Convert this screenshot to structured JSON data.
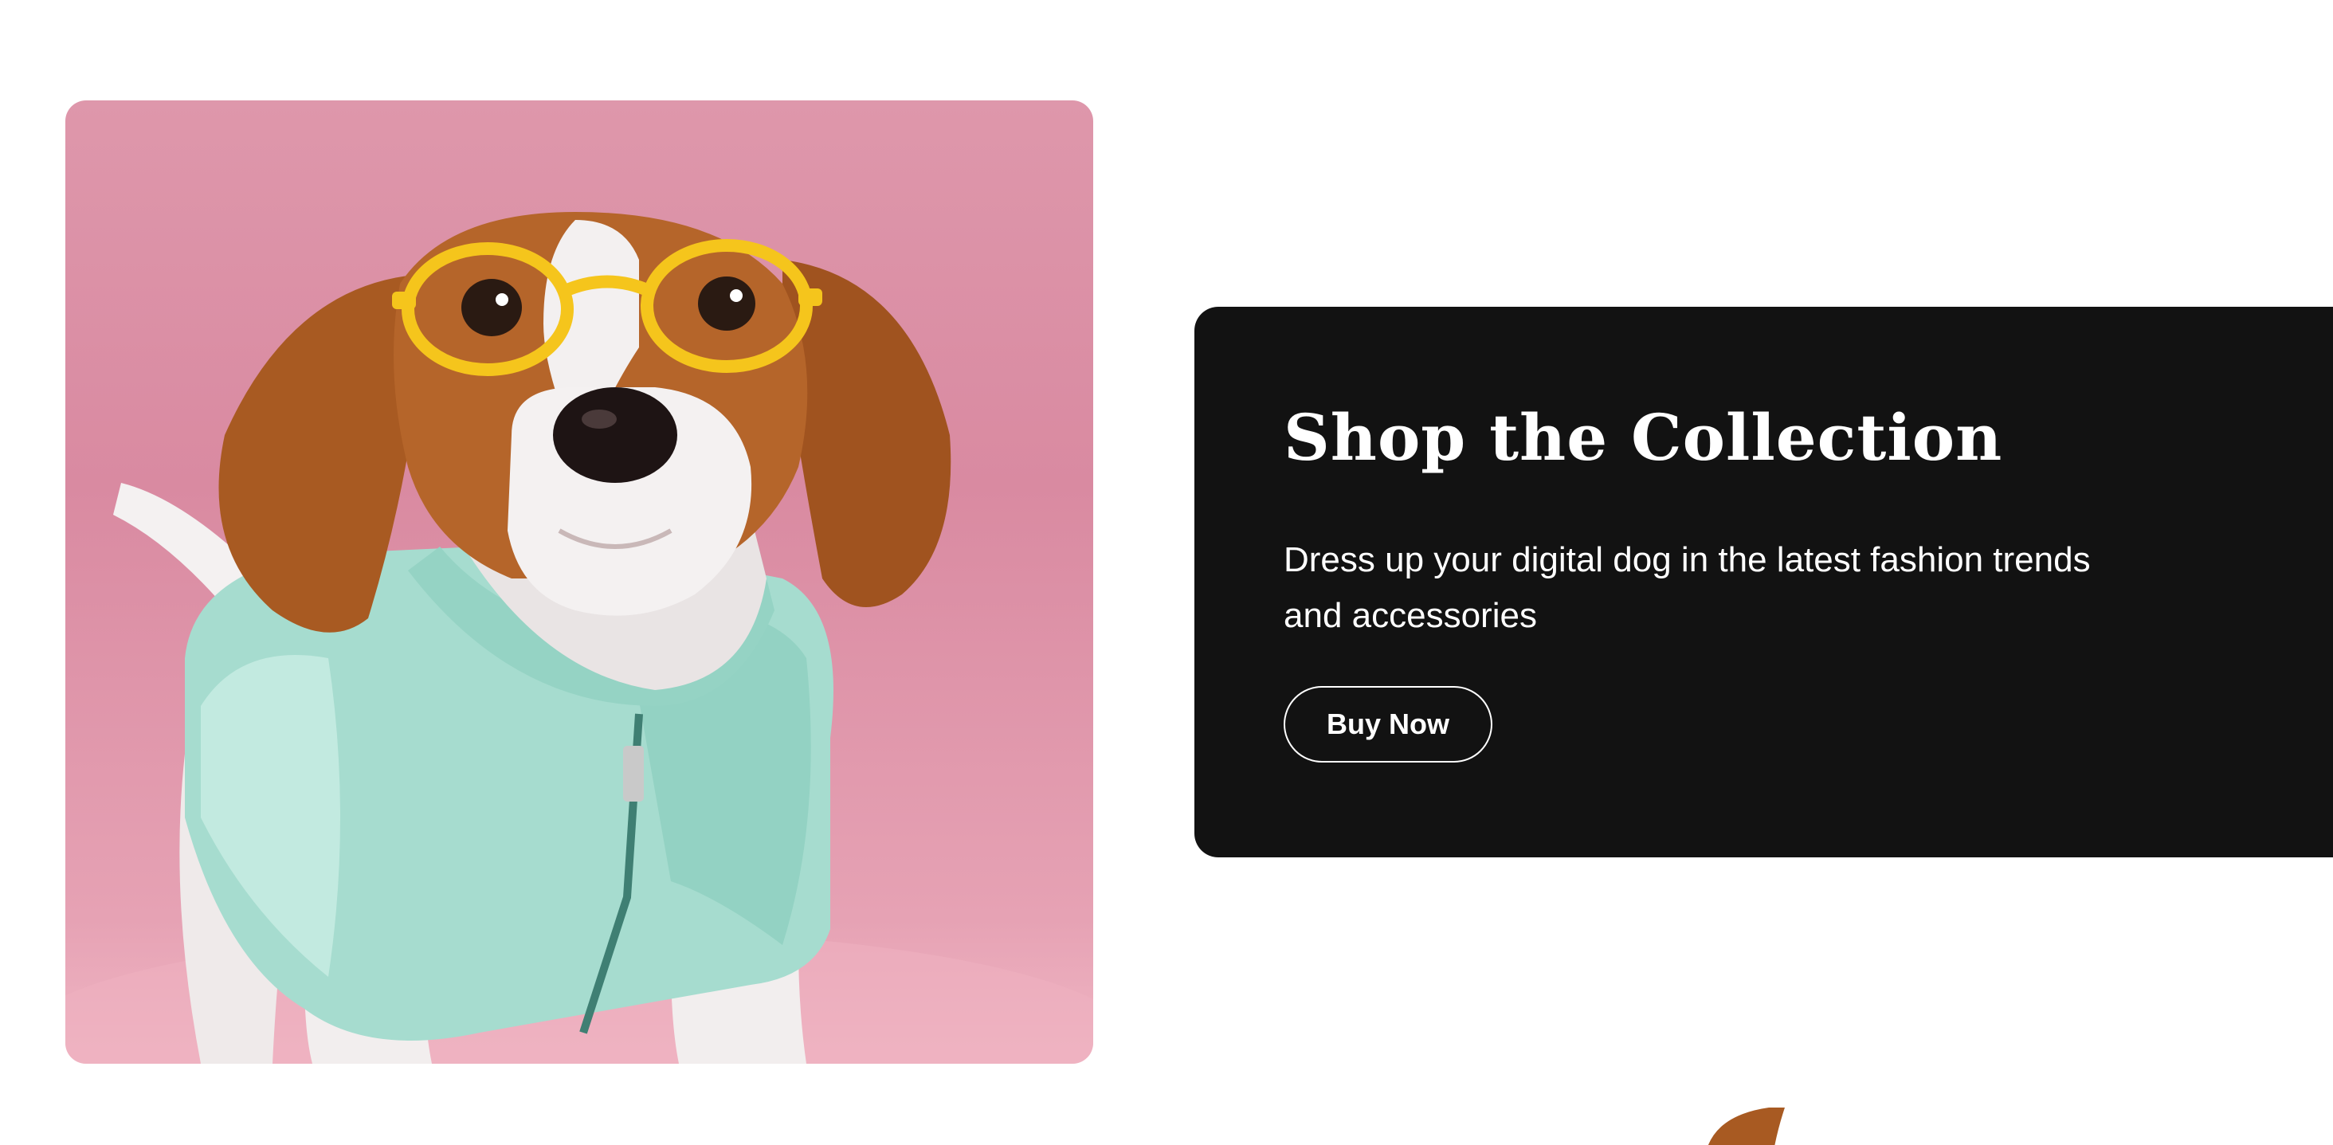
{
  "promo": {
    "title": "Shop the Collection",
    "description": "Dress up your digital dog in the latest fashion trends and accessories",
    "cta_label": "Buy Now"
  },
  "images": {
    "hero_alt_icon": "dog-with-yellow-glasses-and-mint-jacket-image",
    "peek_icon": "dog-ear-partial-image"
  },
  "colors": {
    "panel_background": "#121212",
    "image_background": "#de97ab",
    "text": "#ffffff"
  }
}
